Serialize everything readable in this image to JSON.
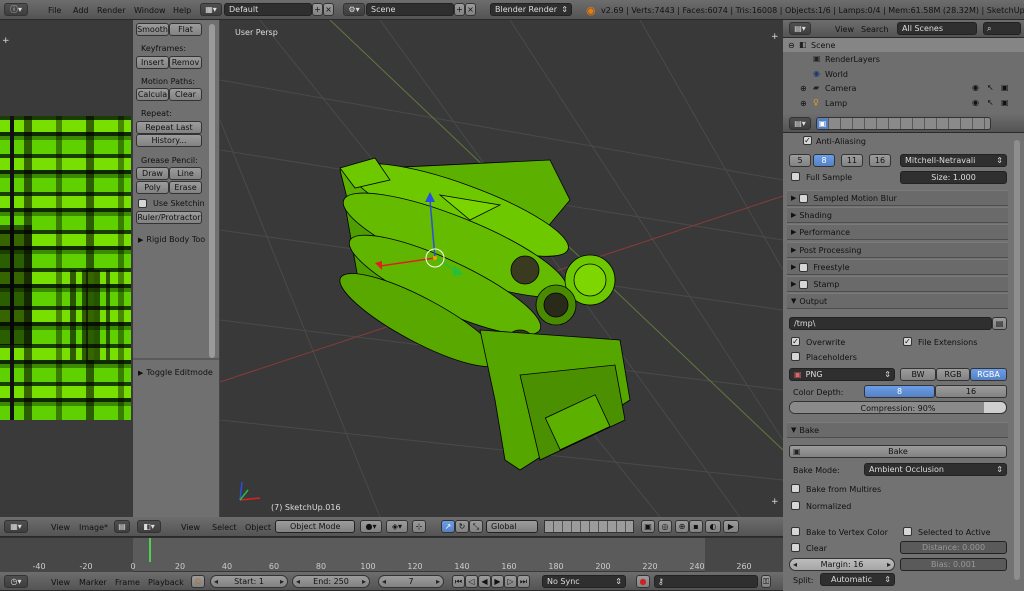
{
  "topbar": {
    "menus": [
      "File",
      "Add",
      "Render",
      "Window",
      "Help"
    ],
    "layout_value": "Default",
    "scene_value": "Scene",
    "engine_value": "Blender Render",
    "stats": "v2.69 | Verts:7443 | Faces:6074 | Tris:16008 | Objects:1/6 | Lamps:0/4 | Mem:61.58M (28.32M) | SketchUp.016"
  },
  "tool_panel": {
    "smooth": "Smooth",
    "flat": "Flat",
    "keyframes_title": "Keyframes:",
    "insert": "Insert",
    "remove": "Remov",
    "motion_title": "Motion Paths:",
    "calculate": "Calcula",
    "clear": "Clear",
    "repeat_title": "Repeat:",
    "repeat_last": "Repeat Last",
    "history": "History...",
    "grease_title": "Grease Pencil:",
    "draw": "Draw",
    "line": "Line",
    "poly": "Poly",
    "erase": "Erase",
    "use_sketching": "Use Sketchin",
    "ruler": "Ruler/Protractor",
    "rigid_body": "Rigid Body Too",
    "toggle_editmode": "Toggle Editmode"
  },
  "viewport": {
    "view_label": "User Persp",
    "object_label": "(7) SketchUp.016"
  },
  "image_editor_header": {
    "view": "View",
    "image": "Image*"
  },
  "view3d_header": {
    "view": "View",
    "select": "Select",
    "object": "Object",
    "mode": "Object Mode",
    "orientation": "Global"
  },
  "outliner": {
    "view": "View",
    "search": "Search",
    "filter": "All Scenes",
    "items": [
      {
        "label": "Scene",
        "indent": 0
      },
      {
        "label": "RenderLayers",
        "indent": 1
      },
      {
        "label": "World",
        "indent": 1
      },
      {
        "label": "Camera",
        "indent": 1
      },
      {
        "label": "Lamp",
        "indent": 1
      }
    ]
  },
  "properties": {
    "anti_aliasing": "Anti-Aliasing",
    "aa_samples": [
      "5",
      "8",
      "11",
      "16"
    ],
    "aa_selected": "8",
    "aa_filter": "Mitchell-Netravali",
    "full_sample": "Full Sample",
    "size": "Size: 1.000",
    "sampled_motion_blur": "Sampled Motion Blur",
    "shading": "Shading",
    "performance": "Performance",
    "post_processing": "Post Processing",
    "freestyle": "Freestyle",
    "stamp": "Stamp",
    "output": "Output",
    "output_path": "/tmp\\",
    "overwrite": "Overwrite",
    "file_extensions": "File Extensions",
    "placeholders": "Placeholders",
    "format": "PNG",
    "color_modes": [
      "BW",
      "RGB",
      "RGBA"
    ],
    "color_selected": "RGBA",
    "color_depth_label": "Color Depth:",
    "depth_8": "8",
    "depth_16": "16",
    "compression": "Compression: 90%",
    "compression_value": 0.9,
    "bake": "Bake",
    "bake_button": "Bake",
    "bake_mode_label": "Bake Mode:",
    "bake_mode": "Ambient Occlusion",
    "bake_from_multires": "Bake from Multires",
    "normalized": "Normalized",
    "bake_to_vertex_color": "Bake to Vertex Color",
    "selected_to_active": "Selected to Active",
    "clear": "Clear",
    "distance": "Distance: 0.000",
    "margin": "Margin: 16",
    "bias": "Bias: 0.001",
    "split_label": "Split:",
    "split_value": "Automatic"
  },
  "timeline": {
    "ticks": [
      "-40",
      "-20",
      "0",
      "20",
      "40",
      "60",
      "80",
      "100",
      "120",
      "140",
      "160",
      "180",
      "200",
      "220",
      "240",
      "260"
    ],
    "current_frame_value": 7,
    "view": "View",
    "marker": "Marker",
    "frame": "Frame",
    "playback": "Playback",
    "start": "Start: 1",
    "end": "End: 250",
    "current": "7",
    "sync": "No Sync"
  },
  "colors": {
    "accent": "#5680c2",
    "model_green": "#6ec800",
    "frame_marker": "#4fd14f"
  }
}
